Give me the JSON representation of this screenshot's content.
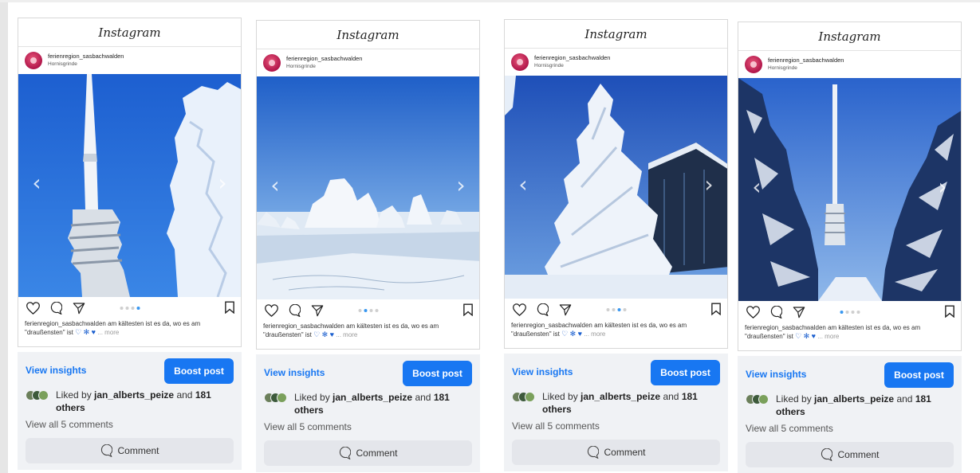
{
  "app_title": "Instagram",
  "posts": [
    {
      "username": "ferienregion_sasbachwalden",
      "location": "Hornisgrinde",
      "caption_text": "ferienregion_sasbachwalden am kältesten ist es da, wo es am \"draußensten\" ist",
      "caption_more": "... more",
      "active_slide": 4,
      "view_insights": "View insights",
      "boost_post": "Boost post",
      "liked_by_prefix": "Liked by",
      "liked_by_user": "jan_alberts_peize",
      "liked_by_mid": "and",
      "liked_by_others": "181 others",
      "view_comments": "View all 5 comments",
      "comment_label": "Comment"
    },
    {
      "username": "ferienregion_sasbachwalden",
      "location": "Hornisgrinde",
      "caption_text": "ferienregion_sasbachwalden am kältesten ist es da, wo es am \"draußensten\" ist",
      "caption_more": "... more",
      "active_slide": 2,
      "view_insights": "View insights",
      "boost_post": "Boost post",
      "liked_by_prefix": "Liked by",
      "liked_by_user": "jan_alberts_peize",
      "liked_by_mid": "and",
      "liked_by_others": "181 others",
      "view_comments": "View all 5 comments",
      "comment_label": "Comment"
    },
    {
      "username": "ferienregion_sasbachwalden",
      "location": "Hornisgrinde",
      "caption_text": "ferienregion_sasbachwalden am kältesten ist es da, wo es am \"draußensten\" ist",
      "caption_more": "... more",
      "active_slide": 3,
      "view_insights": "View insights",
      "boost_post": "Boost post",
      "liked_by_prefix": "Liked by",
      "liked_by_user": "jan_alberts_peize",
      "liked_by_mid": "and",
      "liked_by_others": "181 others",
      "view_comments": "View all 5 comments",
      "comment_label": "Comment"
    },
    {
      "username": "ferienregion_sasbachwalden",
      "location": "Hornisgrinde",
      "caption_text": "ferienregion_sasbachwalden am kältesten ist es da, wo es am \"draußensten\" ist",
      "caption_more": "... more",
      "active_slide": 1,
      "view_insights": "View insights",
      "boost_post": "Boost post",
      "liked_by_prefix": "Liked by",
      "liked_by_user": "jan_alberts_peize",
      "liked_by_mid": "and",
      "liked_by_others": "181 others",
      "view_comments": "View all 5 comments",
      "comment_label": "Comment"
    }
  ],
  "icons": {
    "prev": "chevron-left-icon",
    "next": "chevron-right-icon",
    "like": "heart-icon",
    "comment": "comment-icon",
    "share": "send-icon",
    "save": "bookmark-icon",
    "comment_button": "comment-bubble-icon"
  },
  "colors": {
    "facebook_blue": "#1877f2",
    "instagram_dot_active": "#3897f0",
    "fb_panel": "#f0f2f5",
    "comment_button": "#e4e6eb",
    "sky": "#2f6fd8"
  }
}
